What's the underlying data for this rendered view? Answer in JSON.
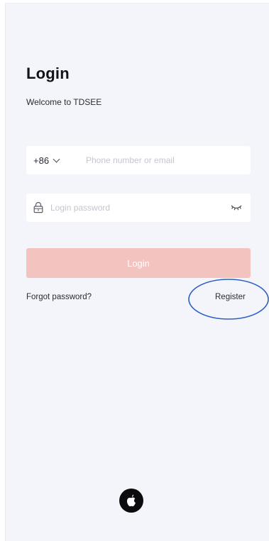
{
  "header": {
    "title": "Login",
    "subtitle": "Welcome to TDSEE"
  },
  "phone_field": {
    "country_code": "+86",
    "placeholder": "Phone number or email",
    "value": ""
  },
  "password_field": {
    "placeholder": "Login password",
    "value": ""
  },
  "login_button": {
    "label": "Login"
  },
  "links": {
    "forgot": "Forgot password?",
    "register": "Register"
  },
  "icons": {
    "country_dropdown": "chevron-down-icon",
    "password": "lock-icon",
    "visibility": "eye-closed-icon",
    "social": "apple-icon"
  },
  "colors": {
    "background": "#f4f5fb",
    "login_button_disabled": "#f3c4bf",
    "annotation_ring": "#2e5fc4"
  }
}
